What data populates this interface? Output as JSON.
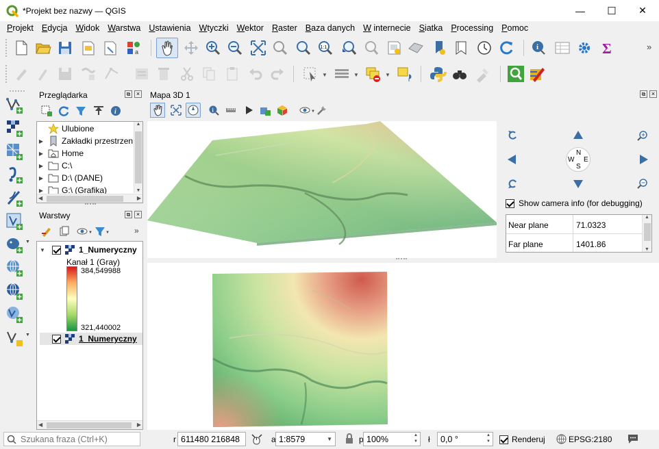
{
  "window": {
    "title": "*Projekt bez nazwy — QGIS",
    "minimize": "—",
    "maximize": "☐",
    "close": "✕"
  },
  "menu": [
    "Projekt",
    "Edycja",
    "Widok",
    "Warstwa",
    "Ustawienia",
    "Wtyczki",
    "Wektor",
    "Raster",
    "Baza danych",
    "W internecie",
    "Siatka",
    "Processing",
    "Pomoc"
  ],
  "browser": {
    "title": "Przeglądarka",
    "items": [
      {
        "label": "Ulubione",
        "icon": "star-icon"
      },
      {
        "label": "Zakładki przestrzen",
        "icon": "bookmark-icon"
      },
      {
        "label": "Home",
        "icon": "folder-home-icon"
      },
      {
        "label": "C:\\",
        "icon": "folder-icon"
      },
      {
        "label": "D:\\ (DANE)",
        "icon": "folder-icon"
      },
      {
        "label": "G:\\ (Grafika)",
        "icon": "folder-icon"
      }
    ]
  },
  "layers": {
    "title": "Warstwy",
    "layer1": "1_Numeryczny",
    "band": "Kanał 1 (Gray)",
    "max": "384,549988",
    "min": "321,440002",
    "layer2": "1_Numeryczny"
  },
  "map3d": {
    "title": "Mapa 3D 1",
    "show_camera_label": "Show camera info (for debugging)",
    "near_label": "Near plane",
    "near_value": "71.0323",
    "far_label": "Far plane",
    "far_value": "1401.86",
    "compass": {
      "n": "N",
      "s": "S",
      "w": "W",
      "e": "E"
    }
  },
  "status": {
    "search_placeholder": "Szukana fraza (Ctrl+K)",
    "coord_label": "r",
    "coords": "611480 216848",
    "scale_label": "a",
    "scale": "1:8579",
    "magnifier_label": "p",
    "magnifier": "100%",
    "rotation_label": "ł",
    "rotation": "0,0 °",
    "render_label": "Renderuj",
    "crs": "EPSG:2180"
  }
}
